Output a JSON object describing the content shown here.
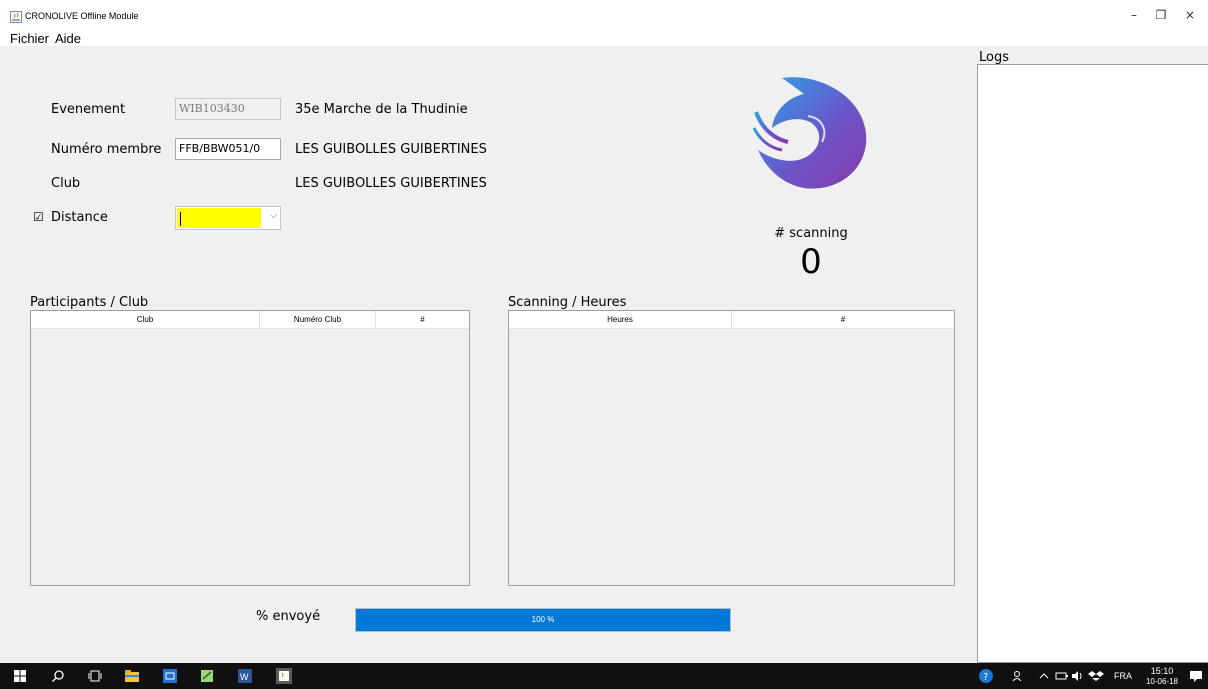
{
  "window": {
    "title": "CRONOLIVE Offline Module",
    "minimize": "–",
    "maximize": "❐",
    "close": "×"
  },
  "menu": [
    "Fichier",
    "Aide"
  ],
  "form": {
    "event_label": "Evenement",
    "event_code": "WIB103430",
    "event_name": "35e Marche de la Thudinie",
    "member_label": "Numéro membre",
    "member_number": "FFB/BBW051/0",
    "member_club": "LES GUIBOLLES GUIBERTINES",
    "club_label": "Club",
    "club_name": "LES GUIBOLLES GUIBERTINES",
    "distance_label": "Distance",
    "distance_checkbox": "☑",
    "distance_value": "",
    "distance_arrow": "⌵"
  },
  "scanning": {
    "label": "# scanning",
    "count": "0"
  },
  "participants": {
    "title": "Participants / Club",
    "columns": [
      "Club",
      "Numéro Club",
      "#"
    ],
    "rows": []
  },
  "scan_hours": {
    "title": "Scanning / Heures",
    "columns": [
      "Heures",
      "#"
    ],
    "rows": []
  },
  "progress": {
    "label": "% envoyé",
    "text": "100 %",
    "percent": 100
  },
  "logs": {
    "title": "Logs"
  },
  "tray": {
    "lang": "FRA",
    "time": "15:10",
    "date": "10-06-18"
  },
  "colors": {
    "accent": "#0078d7",
    "highlight": "#ffff00",
    "taskbar": "#101010"
  }
}
